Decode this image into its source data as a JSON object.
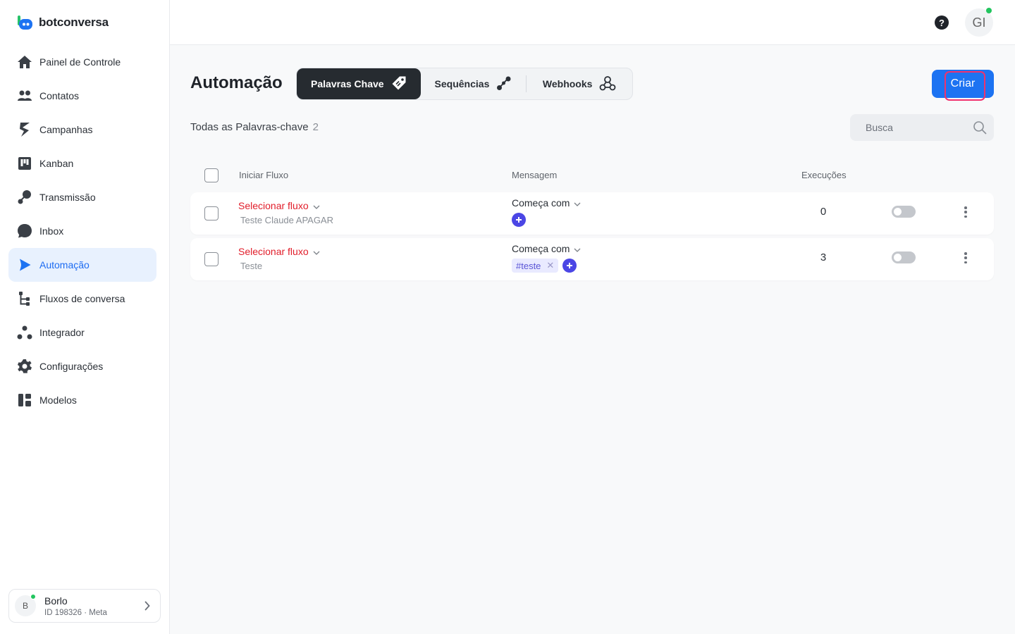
{
  "brand": {
    "name": "botconversa"
  },
  "sidebar": {
    "items": [
      {
        "label": "Painel de Controle",
        "icon": "home-icon"
      },
      {
        "label": "Contatos",
        "icon": "users-icon"
      },
      {
        "label": "Campanhas",
        "icon": "campaign-icon"
      },
      {
        "label": "Kanban",
        "icon": "kanban-icon"
      },
      {
        "label": "Transmissão",
        "icon": "broadcast-icon"
      },
      {
        "label": "Inbox",
        "icon": "chat-bubble-icon"
      },
      {
        "label": "Automação",
        "icon": "automation-icon",
        "active": true
      },
      {
        "label": "Fluxos de conversa",
        "icon": "flow-icon"
      },
      {
        "label": "Integrador",
        "icon": "integrator-icon"
      },
      {
        "label": "Configurações",
        "icon": "gear-icon"
      },
      {
        "label": "Modelos",
        "icon": "templates-icon"
      }
    ],
    "account": {
      "initial": "B",
      "name": "Borlo",
      "subtitle": "ID 198326 · Meta",
      "status_color": "#22c55e"
    }
  },
  "header": {
    "help_glyph": "?",
    "user_initials": "GI",
    "status_color": "#22c55e"
  },
  "main": {
    "title": "Automação",
    "tabs": [
      {
        "label": "Palavras Chave",
        "icon": "tag-icon",
        "active": true
      },
      {
        "label": "Sequências",
        "icon": "sequence-icon"
      },
      {
        "label": "Webhooks",
        "icon": "webhook-icon"
      }
    ],
    "create_label": "Criar",
    "list_title": "Todas as Palavras-chave",
    "list_count": "2",
    "search_placeholder": "Busca",
    "columns": {
      "flow": "Iniciar Fluxo",
      "message": "Mensagem",
      "executions": "Execuções"
    },
    "rows": [
      {
        "flow_select": "Selecionar fluxo",
        "flow_name": "Teste Claude APAGAR",
        "match": "Começa com",
        "keywords": [],
        "executions": "0",
        "enabled": false
      },
      {
        "flow_select": "Selecionar fluxo",
        "flow_name": "Teste",
        "match": "Começa com",
        "keywords": [
          "#teste"
        ],
        "executions": "3",
        "enabled": false
      }
    ]
  },
  "colors": {
    "accent": "#1d73f2",
    "active_nav_bg": "#e8f1fe",
    "flow_select": "#e11d2a",
    "plus": "#4b46e5",
    "focus_ring": "#f0326e"
  }
}
